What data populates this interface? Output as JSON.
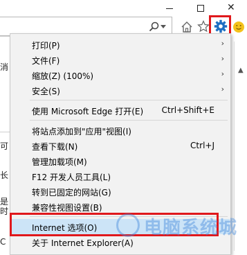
{
  "window": {
    "close_glyph": "✕"
  },
  "page_fragments": [
    "消",
    "可",
    "长",
    "是",
    "时",
    "C"
  ],
  "menu": {
    "items": [
      {
        "label": "打印(P)",
        "shortcut": "",
        "submenu": true
      },
      {
        "label": "文件(F)",
        "shortcut": "",
        "submenu": true
      },
      {
        "label": "缩放(Z) (100%)",
        "shortcut": "",
        "submenu": true
      },
      {
        "label": "安全(S)",
        "shortcut": "",
        "submenu": true
      },
      {
        "label": "使用 Microsoft Edge 打开(E)",
        "shortcut": "Ctrl+Shift+E",
        "submenu": false
      },
      {
        "label": "将站点添加到\"应用\"视图(I)",
        "shortcut": "",
        "submenu": false
      },
      {
        "label": "查看下载(N)",
        "shortcut": "Ctrl+J",
        "submenu": false
      },
      {
        "label": "管理加载项(M)",
        "shortcut": "",
        "submenu": false
      },
      {
        "label": "F12 开发人员工具(L)",
        "shortcut": "",
        "submenu": false
      },
      {
        "label": "转到已固定的网站(G)",
        "shortcut": "",
        "submenu": false
      },
      {
        "label": "兼容性视图设置(B)",
        "shortcut": "",
        "submenu": false
      },
      {
        "label": "Internet 选项(O)",
        "shortcut": "",
        "submenu": false
      },
      {
        "label": "关于 Internet Explorer(A)",
        "shortcut": "",
        "submenu": false
      }
    ],
    "submenu_arrow": "›"
  },
  "watermark": {
    "text": "电脑系统城"
  },
  "colors": {
    "highlight_red": "#e0181c",
    "gear_blue": "#1e6fc2",
    "hover_blue": "#cce4f7"
  }
}
